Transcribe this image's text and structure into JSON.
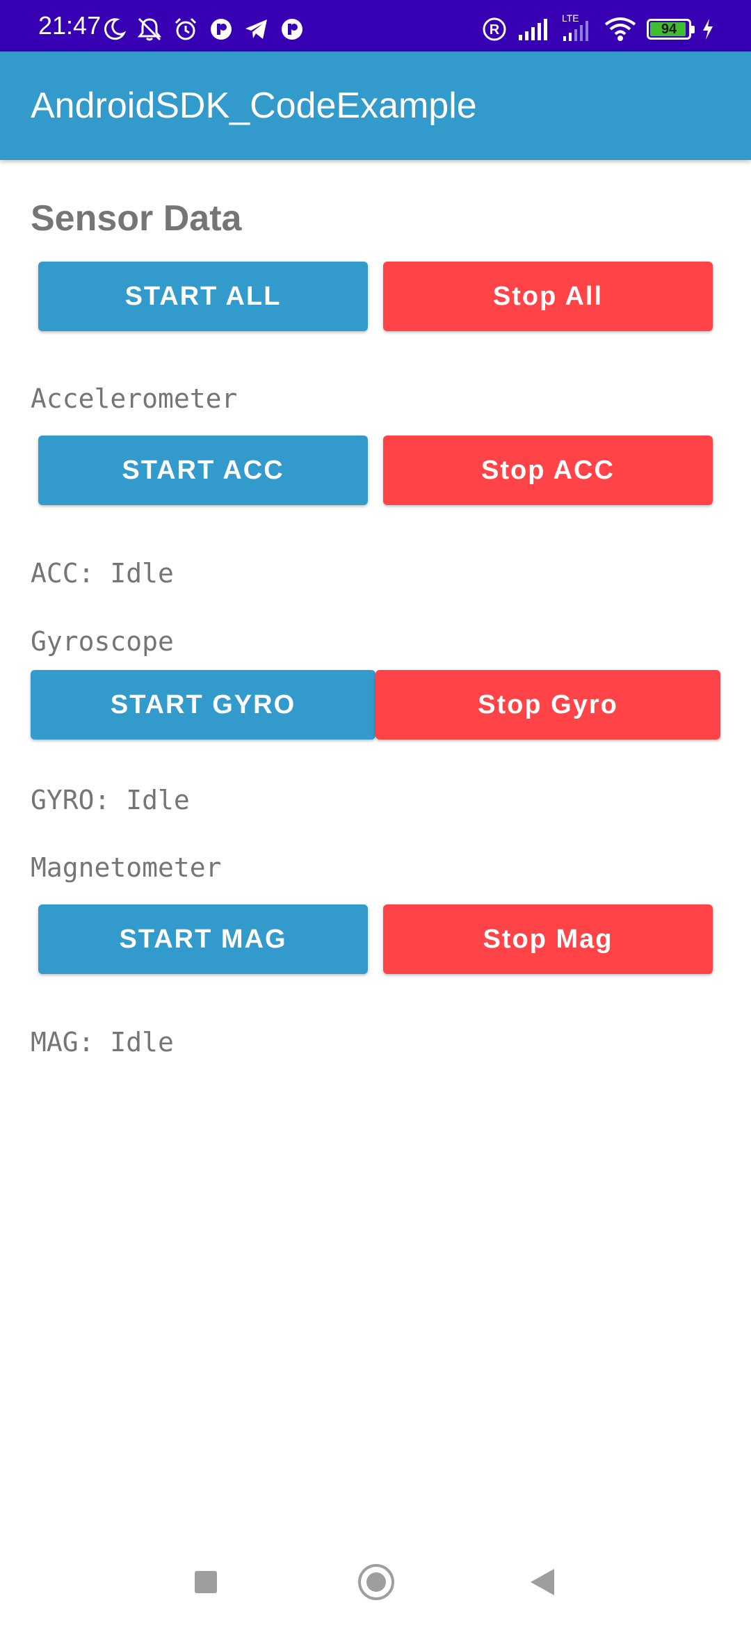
{
  "status_bar": {
    "time": "21:47",
    "battery_level": "94",
    "battery_fraction": 0.94,
    "network_label": "LTE",
    "colors": {
      "background": "#3700B3",
      "battery_fill": "#3FBF2F"
    },
    "left_icons": [
      "moon-icon",
      "bell-off-icon",
      "alarm-icon",
      "app-notification-icon",
      "telegram-icon",
      "app-notification-icon"
    ],
    "right_icons": [
      "registered-icon",
      "signal-icon",
      "lte-signal-icon",
      "wifi-icon",
      "battery-icon",
      "charging-icon"
    ]
  },
  "app_bar": {
    "title": "AndroidSDK_CodeExample",
    "color": "#339BCB"
  },
  "main": {
    "title": "Sensor Data",
    "all": {
      "start_label": "START ALL",
      "stop_label": "Stop All"
    },
    "accelerometer": {
      "label": "Accelerometer",
      "start_label": "START ACC",
      "stop_label": "Stop ACC",
      "status": "ACC: Idle"
    },
    "gyroscope": {
      "label": "Gyroscope",
      "start_label": "START GYRO",
      "stop_label": "Stop Gyro",
      "status": "GYRO: Idle"
    },
    "magnetometer": {
      "label": "Magnetometer",
      "start_label": "START MAG",
      "stop_label": "Stop Mag",
      "status": "MAG: Idle"
    },
    "colors": {
      "start": "#339BCB",
      "stop": "#FF4346",
      "text": "#757575"
    }
  },
  "nav_bar": {
    "icons": [
      "recents-icon",
      "home-icon",
      "back-icon"
    ]
  }
}
